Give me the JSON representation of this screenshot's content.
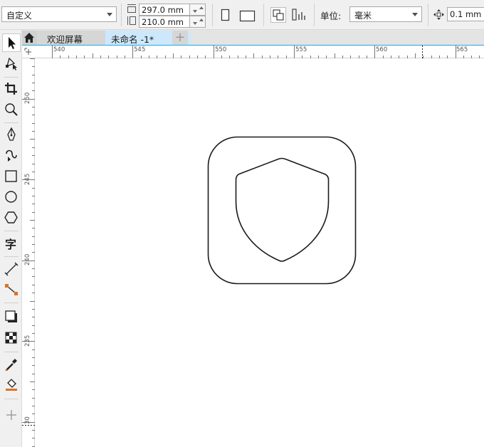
{
  "propbar": {
    "page_size_preset": "自定义",
    "page_width": "297.0 mm",
    "page_height": "210.0 mm",
    "unit_label": "单位:",
    "unit_value": "毫米",
    "nudge_value": "0.1 mm"
  },
  "tabs": [
    {
      "label": "欢迎屏幕"
    },
    {
      "label": "未命名 -1*"
    }
  ],
  "ruler": {
    "top": [
      "540",
      "545",
      "550",
      "555",
      "560",
      "565"
    ],
    "left": [
      "250",
      "245",
      "240",
      "235",
      "30"
    ]
  },
  "colors": {
    "accent": "#22a8e4",
    "active_tab": "#cde8fb",
    "stroke": "#1a1a1a"
  },
  "icons": {
    "canvas_shape": "shield-in-rounded-square"
  }
}
